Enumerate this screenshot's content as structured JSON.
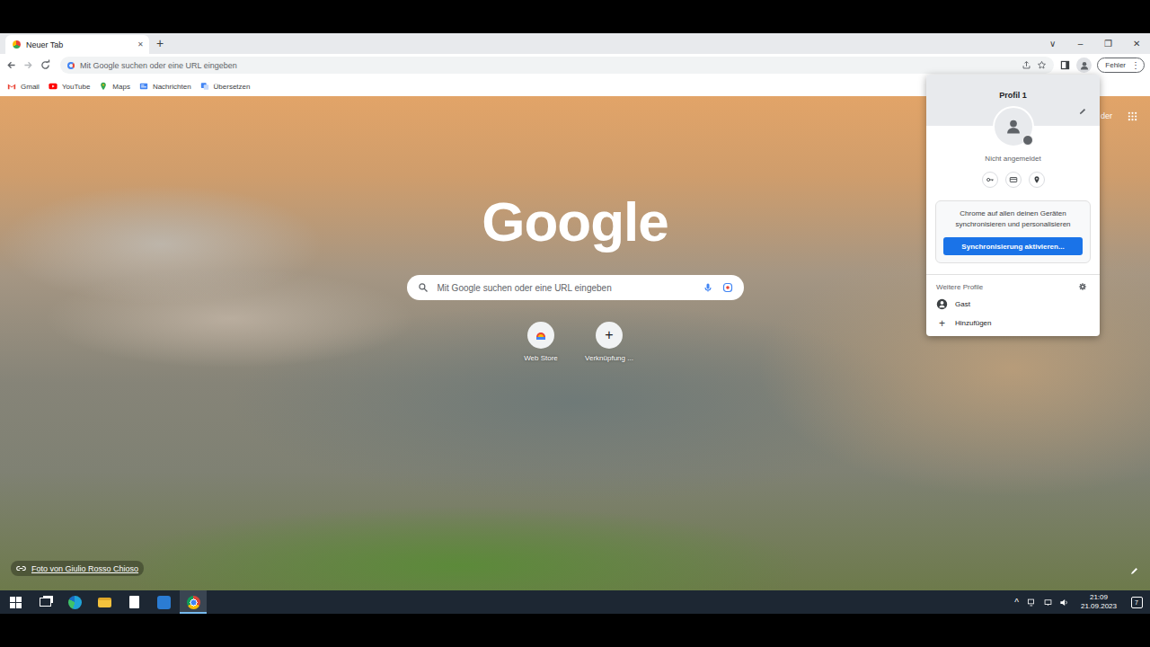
{
  "tabs": [
    {
      "label": "Neuer Tab",
      "selected": true,
      "close": "✕"
    }
  ],
  "new_tab": "+",
  "window_controls": [
    "∨",
    "–",
    "❐",
    "✕"
  ],
  "omnibox": {
    "placeholder": "Mit Google suchen oder eine URL eingeben"
  },
  "profile_chip": {
    "label": "Fehler",
    "menu": "⋮",
    "open": true
  },
  "bookmarks": [
    {
      "label": "Gmail",
      "kind": "mail",
      "color": "#ea4335"
    },
    {
      "label": "YouTube",
      "kind": "video",
      "color": "#ff0000"
    },
    {
      "label": "Maps",
      "kind": "map",
      "color": "#34a853"
    },
    {
      "label": "Nachrichten",
      "kind": "news",
      "color": "#4285f4"
    },
    {
      "label": "Übersetzen",
      "kind": "translate",
      "color": "#4285f4"
    }
  ],
  "new_tab_page": {
    "logo": "Google",
    "search_placeholder": "Mit Google suchen oder eine URL eingeben",
    "top_link": "der",
    "shortcuts": [
      {
        "label": "Web Store",
        "kind": "store"
      },
      {
        "label": "Verknüpfung ...",
        "kind": "add",
        "glyph": "+"
      }
    ],
    "photo_credit": "Foto von Giulio Rosso Chioso"
  },
  "profile_menu": {
    "title": "Profil 1",
    "status": "Nicht angemeldet",
    "sync_text": "Chrome auf allen deinen Geräten synchronisieren und personalisieren",
    "sync_button": "Synchronisierung aktivieren...",
    "other_heading": "Weitere Profile",
    "profiles": [
      {
        "label": "Gast",
        "kind": "guest"
      },
      {
        "label": "Hinzufügen",
        "kind": "add",
        "glyph": "+"
      }
    ]
  },
  "taskbar": {
    "apps": [
      {
        "kind": "start",
        "selected": false
      },
      {
        "kind": "taskview",
        "selected": false
      },
      {
        "kind": "edge",
        "selected": false
      },
      {
        "kind": "explorer",
        "selected": false
      },
      {
        "kind": "file",
        "selected": false
      },
      {
        "kind": "app",
        "selected": false
      },
      {
        "kind": "chrome",
        "selected": true
      }
    ],
    "tray_chevron": "^",
    "time": "21:09",
    "date": "21.09.2023",
    "notifications": "7"
  }
}
